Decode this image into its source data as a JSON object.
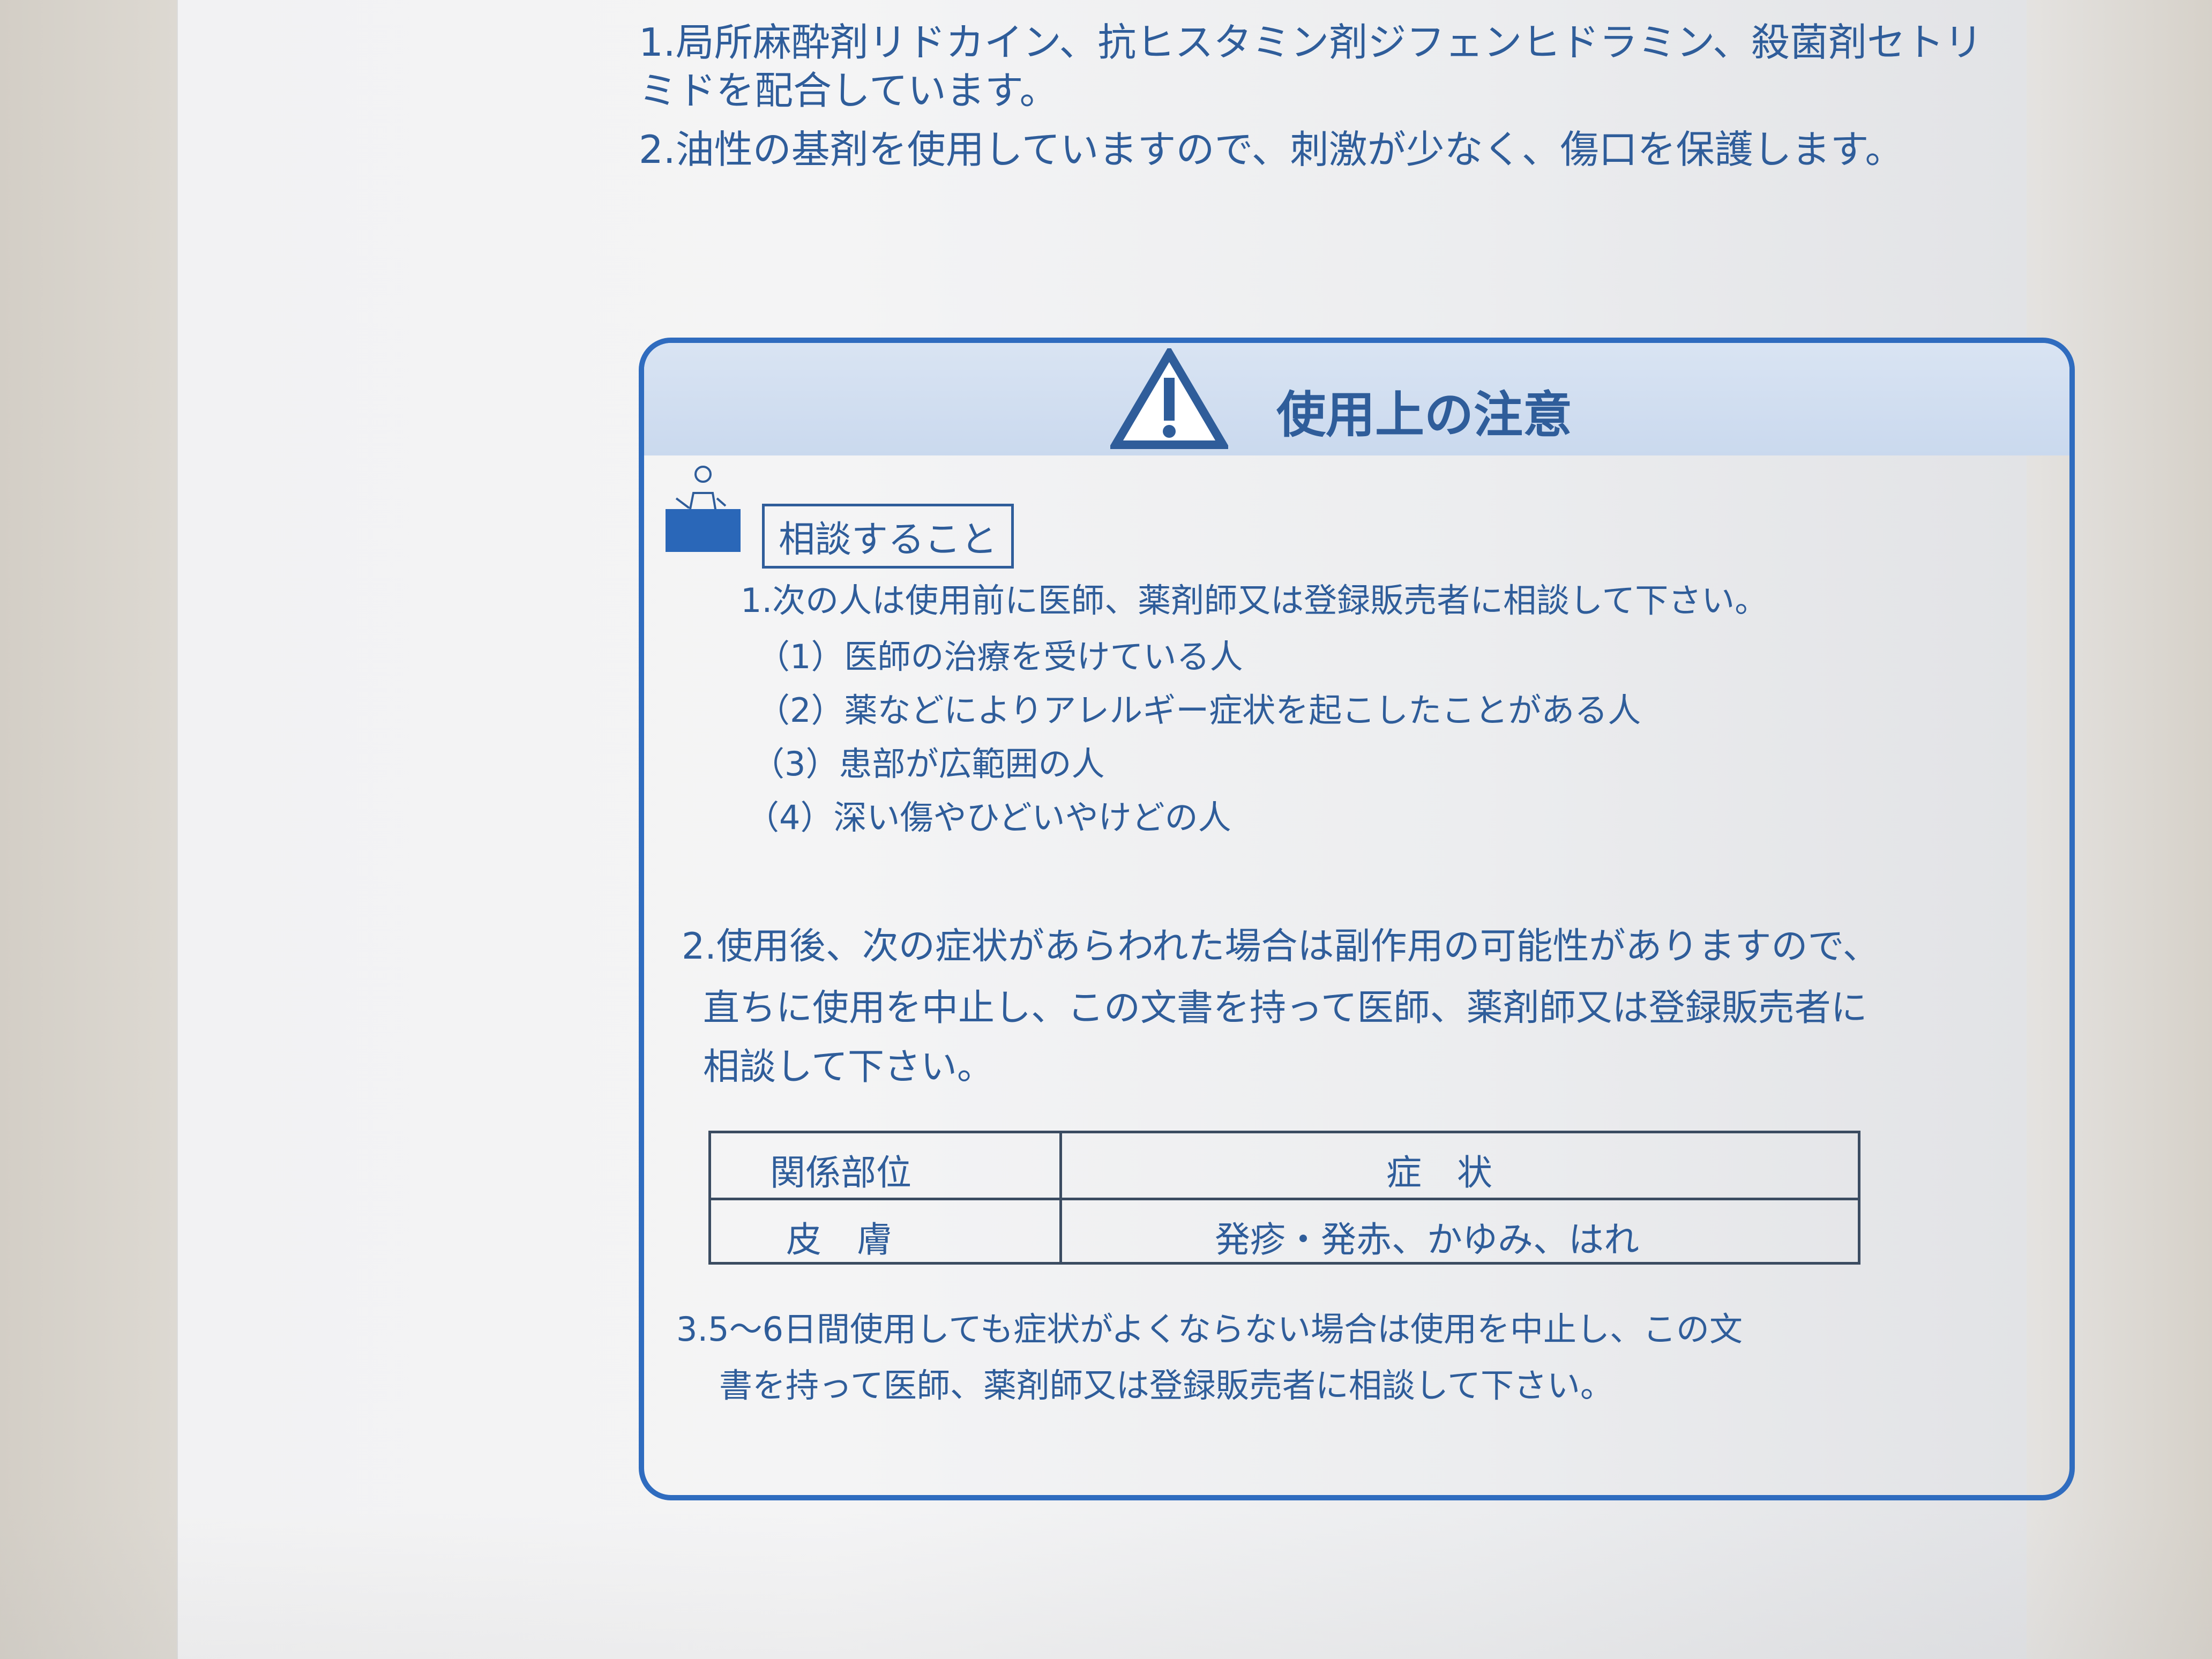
{
  "top_text": {
    "line1": "1.局所麻酔剤リドカイン、抗ヒスタミン剤ジフェンヒドラミン、殺菌剤セトリ",
    "line2": "ミドを配合しています。",
    "line3": "2.油性の基剤を使用していますので、刺激が少なく、傷口を保護します。"
  },
  "panel": {
    "title": "使用上の注意",
    "consult_label": "相談すること",
    "section1_lead": "1.次の人は使用前に医師、薬剤師又は登録販売者に相談して下さい。",
    "section1_items": [
      "（1）医師の治療を受けている人",
      "（2）薬などによりアレルギー症状を起こしたことがある人",
      "（3）患部が広範囲の人",
      "（4）深い傷やひどいやけどの人"
    ],
    "section2_line1": "2.使用後、次の症状があらわれた場合は副作用の可能性がありますので、",
    "section2_line2": "直ちに使用を中止し、この文書を持って医師、薬剤師又は登録販売者に",
    "section2_line3": "相談して下さい。",
    "table": {
      "headers": [
        "関係部位",
        "症　状"
      ],
      "rows": [
        [
          "皮　膚",
          "発疹・発赤、かゆみ、はれ"
        ]
      ]
    },
    "section3_line1": "3.5〜6日間使用しても症状がよくならない場合は使用を中止し、この文",
    "section3_line2": "書を持って医師、薬剤師又は登録販売者に相談して下さい。"
  },
  "icons": {
    "warning": "warning-triangle-icon",
    "consult": "consult-person-icon"
  },
  "colors": {
    "text_blue": "#2f5d9a",
    "panel_blue": "#2f6cbf",
    "header_fill": "#d9e4f3"
  }
}
